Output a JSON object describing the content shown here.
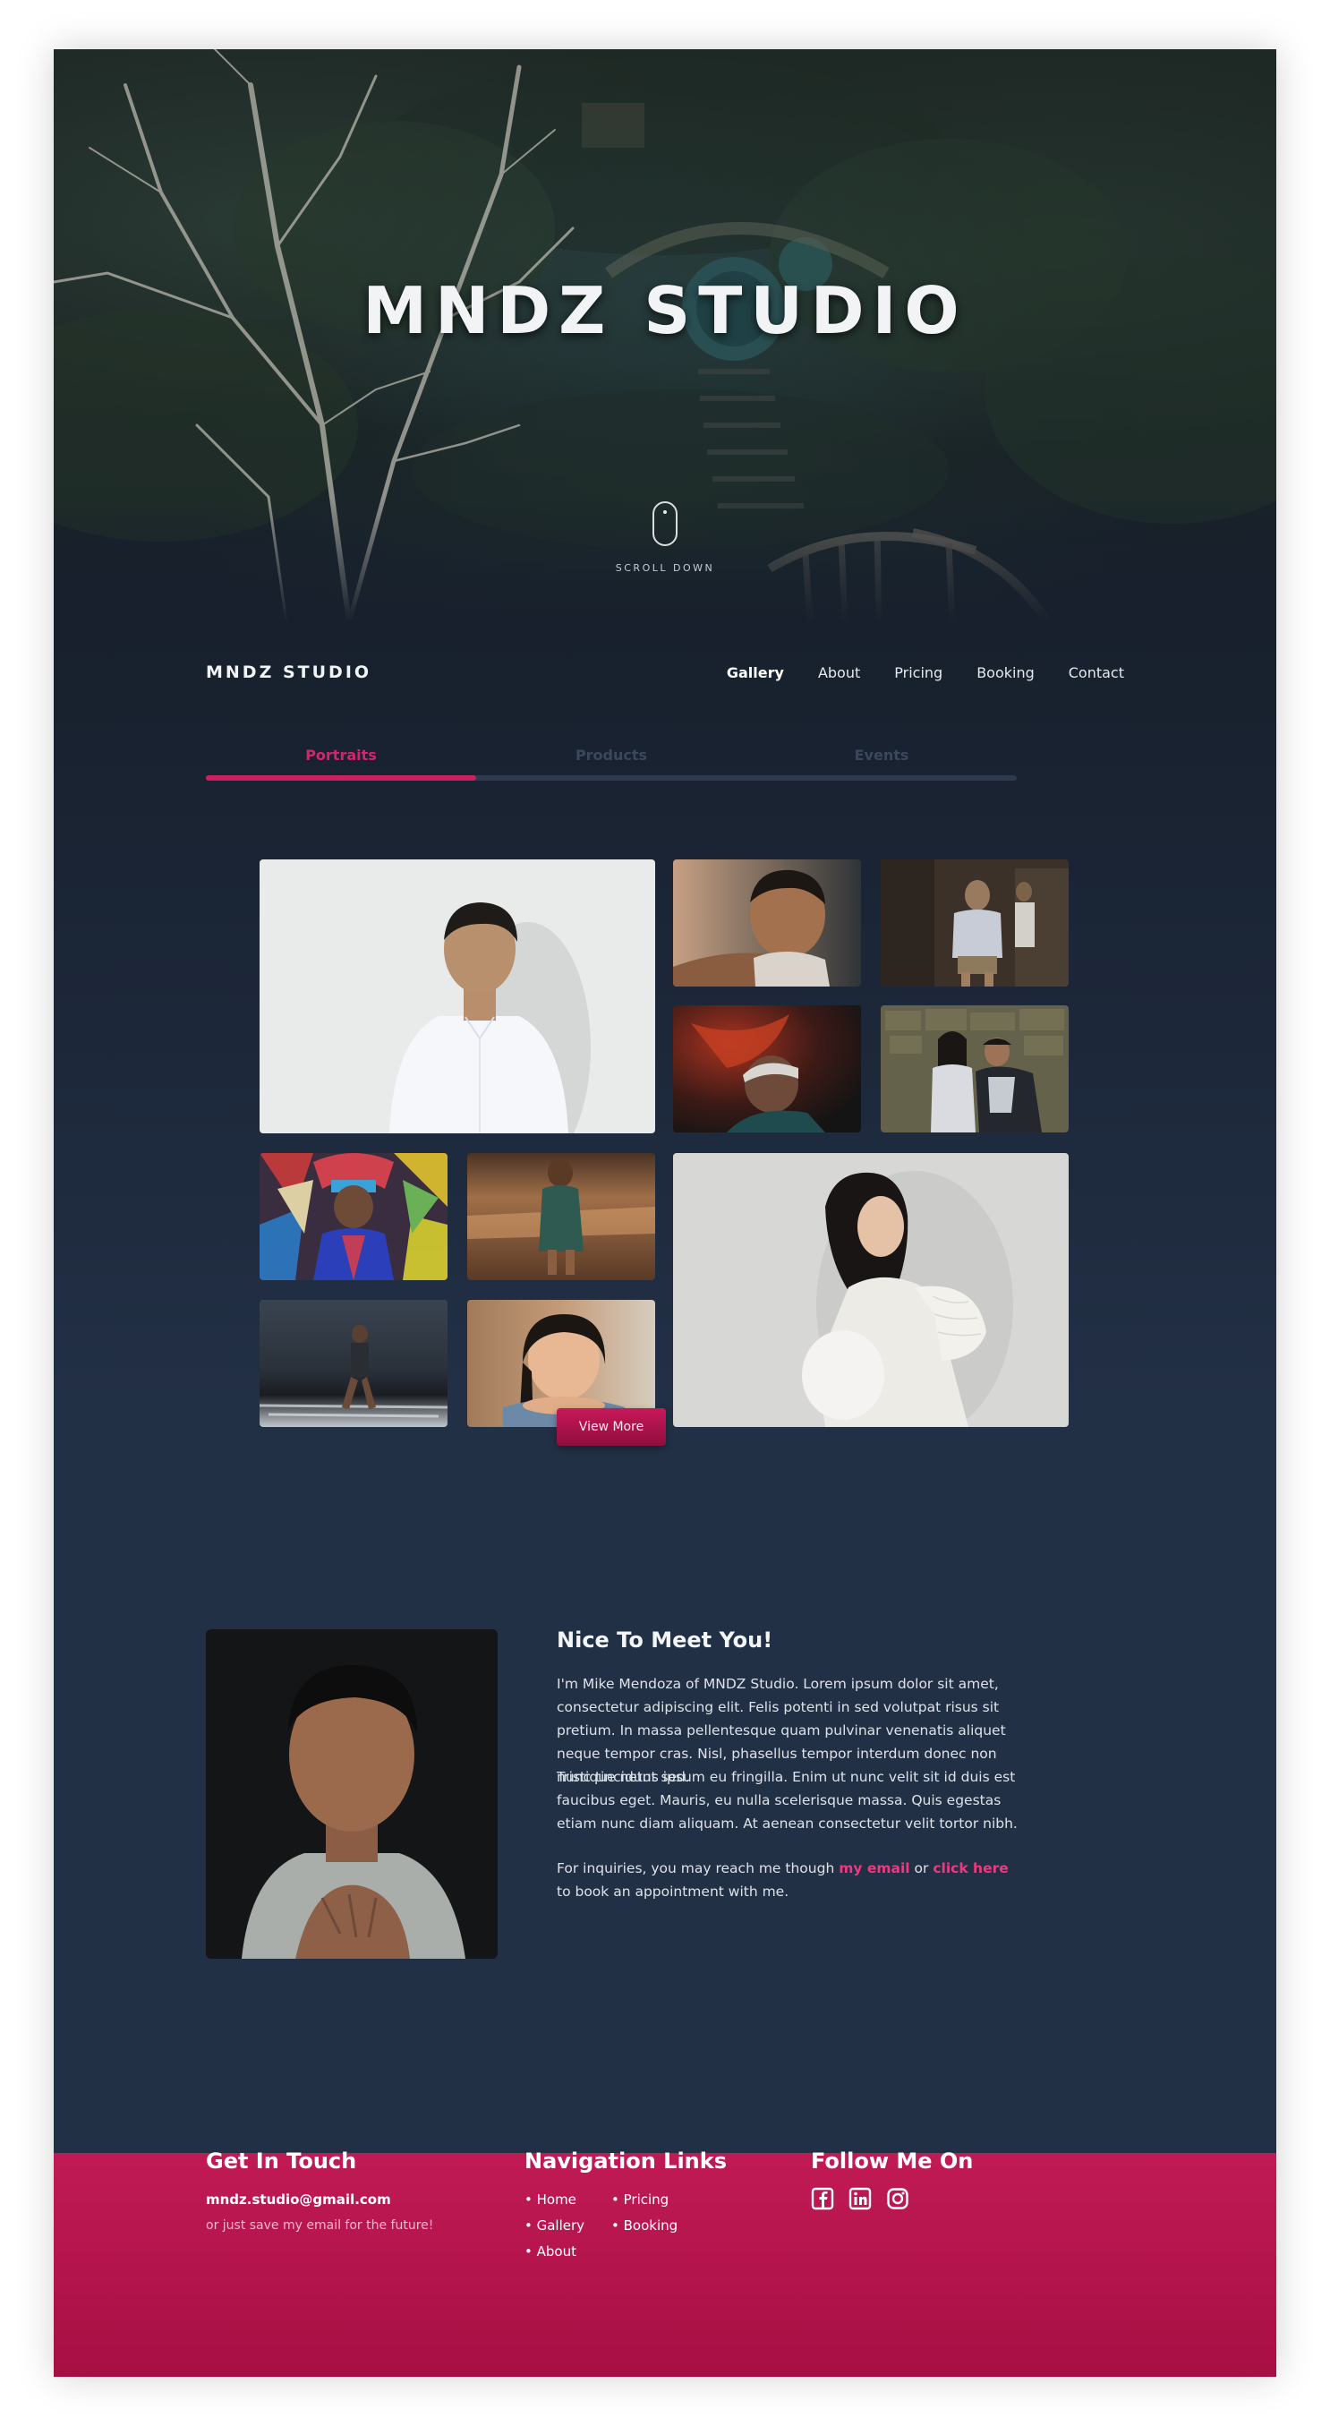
{
  "hero": {
    "title": "MNDZ STUDIO",
    "scroll_label": "SCROLL DOWN"
  },
  "nav": {
    "brand": "MNDZ STUDIO",
    "links": [
      {
        "label": "Gallery",
        "active": true
      },
      {
        "label": "About",
        "active": false
      },
      {
        "label": "Pricing",
        "active": false
      },
      {
        "label": "Booking",
        "active": false
      },
      {
        "label": "Contact",
        "active": false
      }
    ]
  },
  "tabs": [
    {
      "label": "Portraits",
      "active": true
    },
    {
      "label": "Products",
      "active": false
    },
    {
      "label": "Events",
      "active": false
    }
  ],
  "gallery": {
    "photos": [
      "portrait-man-white-shirt",
      "child-smiling",
      "elderly-man-street",
      "man-red-light",
      "couple-stone-wall",
      "festival-costume",
      "girl-on-beach",
      "boy-at-shore",
      "girl-resting-chin",
      "pregnant-woman"
    ],
    "view_more_label": "View More"
  },
  "about": {
    "heading": "Nice To Meet You!",
    "para1": "I'm Mike Mendoza of MNDZ Studio. Lorem ipsum dolor sit amet, consectetur adipiscing elit. Felis potenti in sed volutpat risus sit pretium. In massa pellentesque quam pulvinar venenatis aliquet neque tempor cras. Nisl, phasellus tempor interdum donec non nunc tincidunt sed.",
    "para2": "Tristique netus ipsum eu fringilla. Enim ut nunc velit sit id duis est faucibus eget. Mauris, eu nulla scelerisque massa. Quis egestas etiam nunc diam aliquam. At aenean consectetur velit tortor nibh.",
    "para3_before": "For inquiries, you may reach me though ",
    "email_link": "my email",
    "para3_mid": " or ",
    "click_link": "click here",
    "para3_after": " to book an appointment with me."
  },
  "footer": {
    "get_in_touch": "Get In Touch",
    "email": "mndz.studio@gmail.com",
    "email_note": "or just save my email for the future!",
    "nav_heading": "Navigation Links",
    "nav_links": [
      "• Home",
      "• Gallery",
      "• About",
      "• Pricing",
      "• Booking"
    ],
    "follow_heading": "Follow Me On",
    "social_icons": [
      "facebook-icon",
      "linkedin-icon",
      "instagram-icon"
    ]
  },
  "colors": {
    "accent": "#cf1f5e",
    "background": "#223046",
    "footer": "#b3134a"
  }
}
